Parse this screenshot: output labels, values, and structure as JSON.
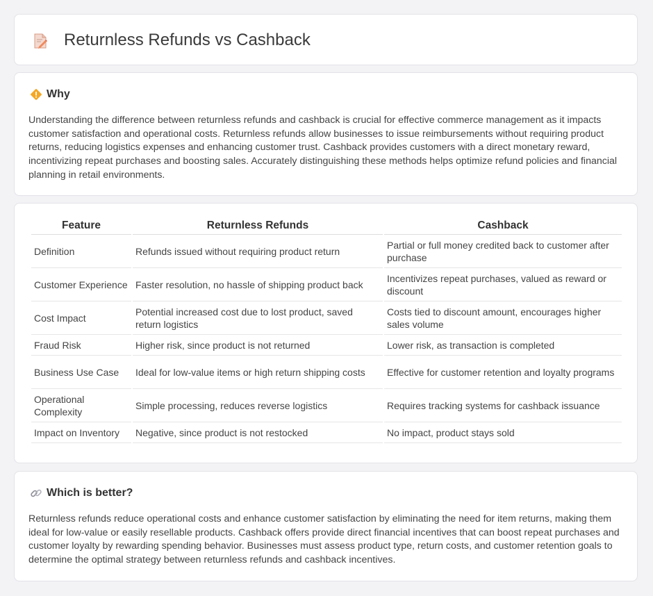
{
  "header": {
    "title": "Returnless Refunds vs Cashback",
    "icon": "document-pen-icon"
  },
  "why": {
    "icon": "diamond-signal-icon",
    "heading": "Why",
    "body": "Understanding the difference between returnless refunds and cashback is crucial for effective commerce management as it impacts customer satisfaction and operational costs. Returnless refunds allow businesses to issue reimbursements without requiring product returns, reducing logistics expenses and enhancing customer trust. Cashback provides customers with a direct monetary reward, incentivizing repeat purchases and boosting sales. Accurately distinguishing these methods helps optimize refund policies and financial planning in retail environments."
  },
  "comparison": {
    "headers": [
      "Feature",
      "Returnless Refunds",
      "Cashback"
    ],
    "rows": [
      [
        "Definition",
        "Refunds issued without requiring product return",
        "Partial or full money credited back to customer after purchase"
      ],
      [
        "Customer Experience",
        "Faster resolution, no hassle of shipping product back",
        "Incentivizes repeat purchases, valued as reward or discount"
      ],
      [
        "Cost Impact",
        "Potential increased cost due to lost product, saved return logistics",
        "Costs tied to discount amount, encourages higher sales volume"
      ],
      [
        "Fraud Risk",
        "Higher risk, since product is not returned",
        "Lower risk, as transaction is completed"
      ],
      [
        "Business Use Case",
        "Ideal for low-value items or high return shipping costs",
        "Effective for customer retention and loyalty programs"
      ],
      [
        "Operational Complexity",
        "Simple processing, reduces reverse logistics",
        "Requires tracking systems for cashback issuance"
      ],
      [
        "Impact on Inventory",
        "Negative, since product is not restocked",
        "No impact, product stays sold"
      ]
    ]
  },
  "better": {
    "icon": "link-icon",
    "heading": "Which is better?",
    "body": "Returnless refunds reduce operational costs and enhance customer satisfaction by eliminating the need for item returns, making them ideal for low-value or easily resellable products. Cashback offers provide direct financial incentives that can boost repeat purchases and customer loyalty by rewarding spending behavior. Businesses must assess product type, return costs, and customer retention goals to determine the optimal strategy between returnless refunds and cashback incentives."
  }
}
